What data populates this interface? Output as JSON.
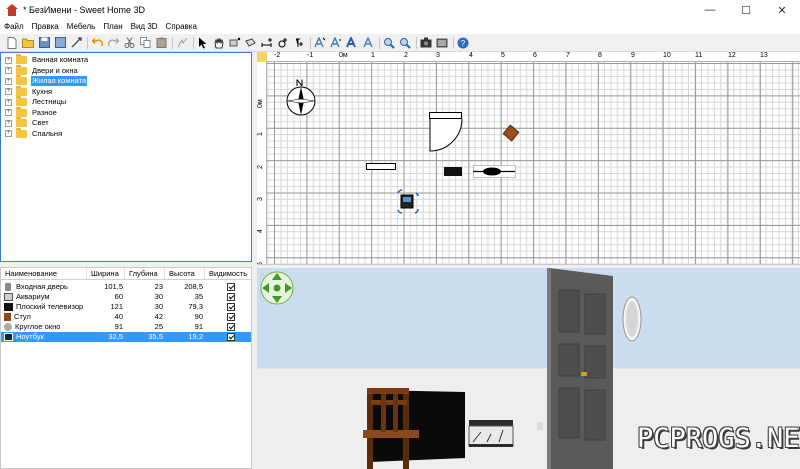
{
  "window": {
    "title": "* БезИмени - Sweet Home 3D",
    "controls": {
      "minimize": "—",
      "maximize": "☐",
      "close": "✕"
    }
  },
  "menu": [
    "Файл",
    "Правка",
    "Мебель",
    "План",
    "Вид 3D",
    "Справка"
  ],
  "toolbar": {
    "icons": [
      "new-file-icon",
      "open-icon",
      "save-icon",
      "cut-icon-alt",
      "undo-icon",
      "redo-icon",
      "cut-icon",
      "copy-icon",
      "paste-icon",
      "add-furniture-icon",
      "select-icon",
      "pan-icon",
      "create-walls-icon",
      "create-rooms-icon",
      "create-dimensions-icon",
      "create-polylines-icon",
      "add-text-icon",
      "text-style-1-icon",
      "text-style-2-icon",
      "text-style-3-icon",
      "text-style-4-icon",
      "zoom-in-icon",
      "zoom-out-icon",
      "photo-icon",
      "video-icon",
      "help-icon"
    ]
  },
  "catalog": {
    "categories": [
      {
        "label": "Ванная комната",
        "selected": false
      },
      {
        "label": "Двери и окна",
        "selected": false
      },
      {
        "label": "Жилая комната",
        "selected": true
      },
      {
        "label": "Кухня",
        "selected": false
      },
      {
        "label": "Лестницы",
        "selected": false
      },
      {
        "label": "Разное",
        "selected": false
      },
      {
        "label": "Свет",
        "selected": false
      },
      {
        "label": "Спальня",
        "selected": false
      }
    ],
    "expander": "+"
  },
  "furniture": {
    "columns": [
      "Наименование",
      "Ширина",
      "Глубина",
      "Высота",
      "Видимость"
    ],
    "rows": [
      {
        "name": "Входная дверь",
        "width": "101,5",
        "depth": "23",
        "height": "208,5",
        "visible": true,
        "icon_color": "#777777",
        "selected": false
      },
      {
        "name": "Аквариум",
        "width": "60",
        "depth": "30",
        "height": "35",
        "visible": true,
        "icon_color": "#555555",
        "selected": false
      },
      {
        "name": "Плоский телевизор",
        "width": "121",
        "depth": "30",
        "height": "79,3",
        "visible": true,
        "icon_color": "#111111",
        "selected": false
      },
      {
        "name": "Стул",
        "width": "40",
        "depth": "42",
        "height": "90",
        "visible": true,
        "icon_color": "#8b4a1c",
        "selected": false
      },
      {
        "name": "Круглое окно",
        "width": "91",
        "depth": "25",
        "height": "91",
        "visible": true,
        "icon_color": "#999999",
        "selected": false
      },
      {
        "name": "Ноутбук",
        "width": "32,5",
        "depth": "35,5",
        "height": "19,2",
        "visible": true,
        "icon_color": "#222222",
        "selected": true
      }
    ]
  },
  "plan": {
    "ruler_top": [
      "-2",
      "-1",
      "0м",
      "1",
      "2",
      "3",
      "4",
      "5",
      "6",
      "7",
      "8",
      "9",
      "10",
      "11",
      "12",
      "13"
    ],
    "ruler_left": [
      "0м",
      "1",
      "2",
      "3",
      "4",
      "5"
    ],
    "compass_label": "N"
  },
  "view3d": {
    "sky_color": "#c9ddef",
    "ground_color": "#eeeeee",
    "door_knob_color": "#d4a017"
  },
  "watermark": "PCPROGS.NET"
}
